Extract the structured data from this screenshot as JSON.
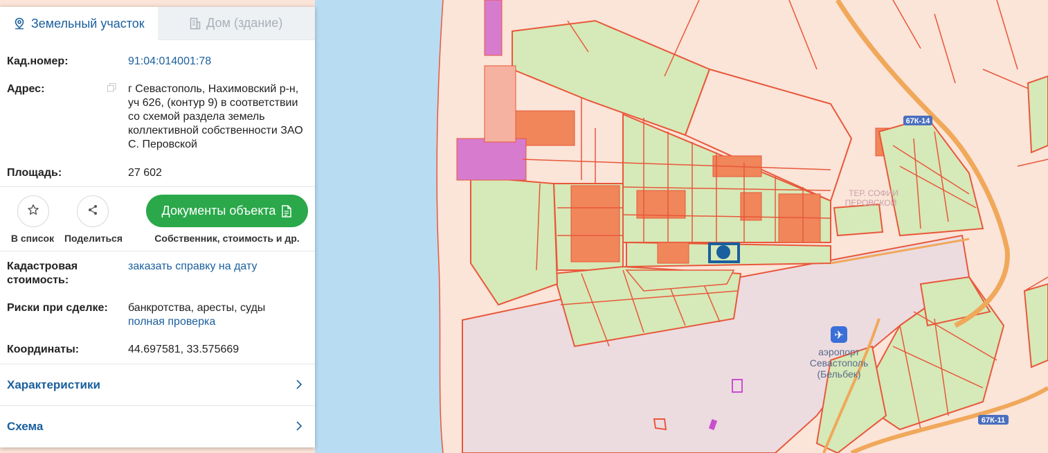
{
  "tabs": [
    {
      "label": "Земельный участок",
      "icon": "map-pin-icon",
      "active": true
    },
    {
      "label": "Дом (здание)",
      "icon": "building-icon",
      "active": false
    }
  ],
  "info": {
    "cad_label": "Кад.номер:",
    "cad_value": "91:04:014001:78",
    "address_label": "Адрес:",
    "address_lines": [
      "г Севастополь, Нахимовский р-н,",
      "уч 626, (контур 9) в соответствии",
      "со схемой раздела земель",
      "коллективной собственности ЗАО",
      "С. Перовской"
    ],
    "area_label": "Площадь:",
    "area_value": "27 602"
  },
  "actions": {
    "favorite_label": "В список",
    "share_label": "Поделиться",
    "docs_button": "Документы объекта",
    "docs_caption": "Собственник, стоимость и др."
  },
  "details": {
    "cost_label_1": "Кадастровая",
    "cost_label_2": "стоимость:",
    "cost_link": "заказать справку на дату",
    "risk_label": "Риски при сделке:",
    "risk_text": "банкротства, аресты, суды",
    "risk_link": "полная проверка",
    "coords_label": "Координаты:",
    "coords_value": "44.697581, 33.575669"
  },
  "sections": {
    "characteristics": "Характеристики",
    "scheme": "Схема"
  },
  "map": {
    "road_badge_1": "67К-14",
    "road_badge_2": "67К-11",
    "airport_line_1": "аэропорт",
    "airport_line_2": "Севастополь",
    "airport_line_3": "(Бельбек)",
    "locality_line_1": "ТЕР. СОФИИ",
    "locality_line_2": "ПЕРОВСКОЙ",
    "colors": {
      "sea": "#b8dcf2",
      "land": "#fbe4d8",
      "parcel_outline": "#e8573a",
      "parcel_green": "#d6e9b8",
      "airfield": "#ecdce0",
      "road": "#f0a85a",
      "accent_blue": "#1a5f9e",
      "button_green": "#2aa84a"
    }
  }
}
